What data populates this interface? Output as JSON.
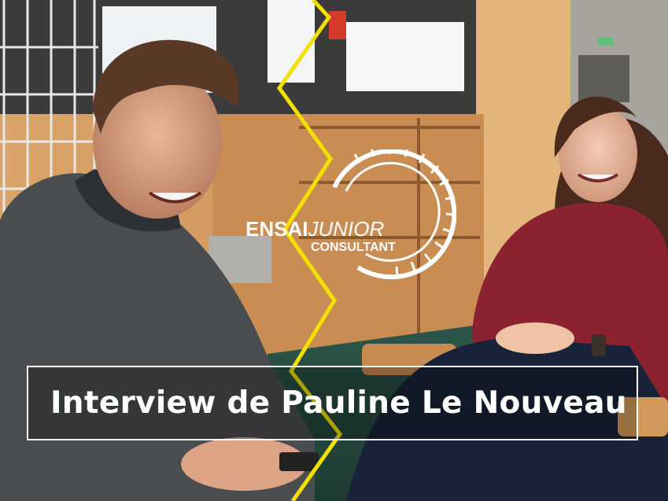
{
  "logo": {
    "brand_primary": "ENSAI",
    "brand_secondary": "JUNIOR",
    "brand_tertiary": "CONSULTANT"
  },
  "caption": {
    "title": "Interview de Pauline Le Nouveau"
  },
  "colors": {
    "accent_split_line": "#f2e100",
    "caption_text": "#ffffff",
    "caption_border": "#ffffff"
  }
}
